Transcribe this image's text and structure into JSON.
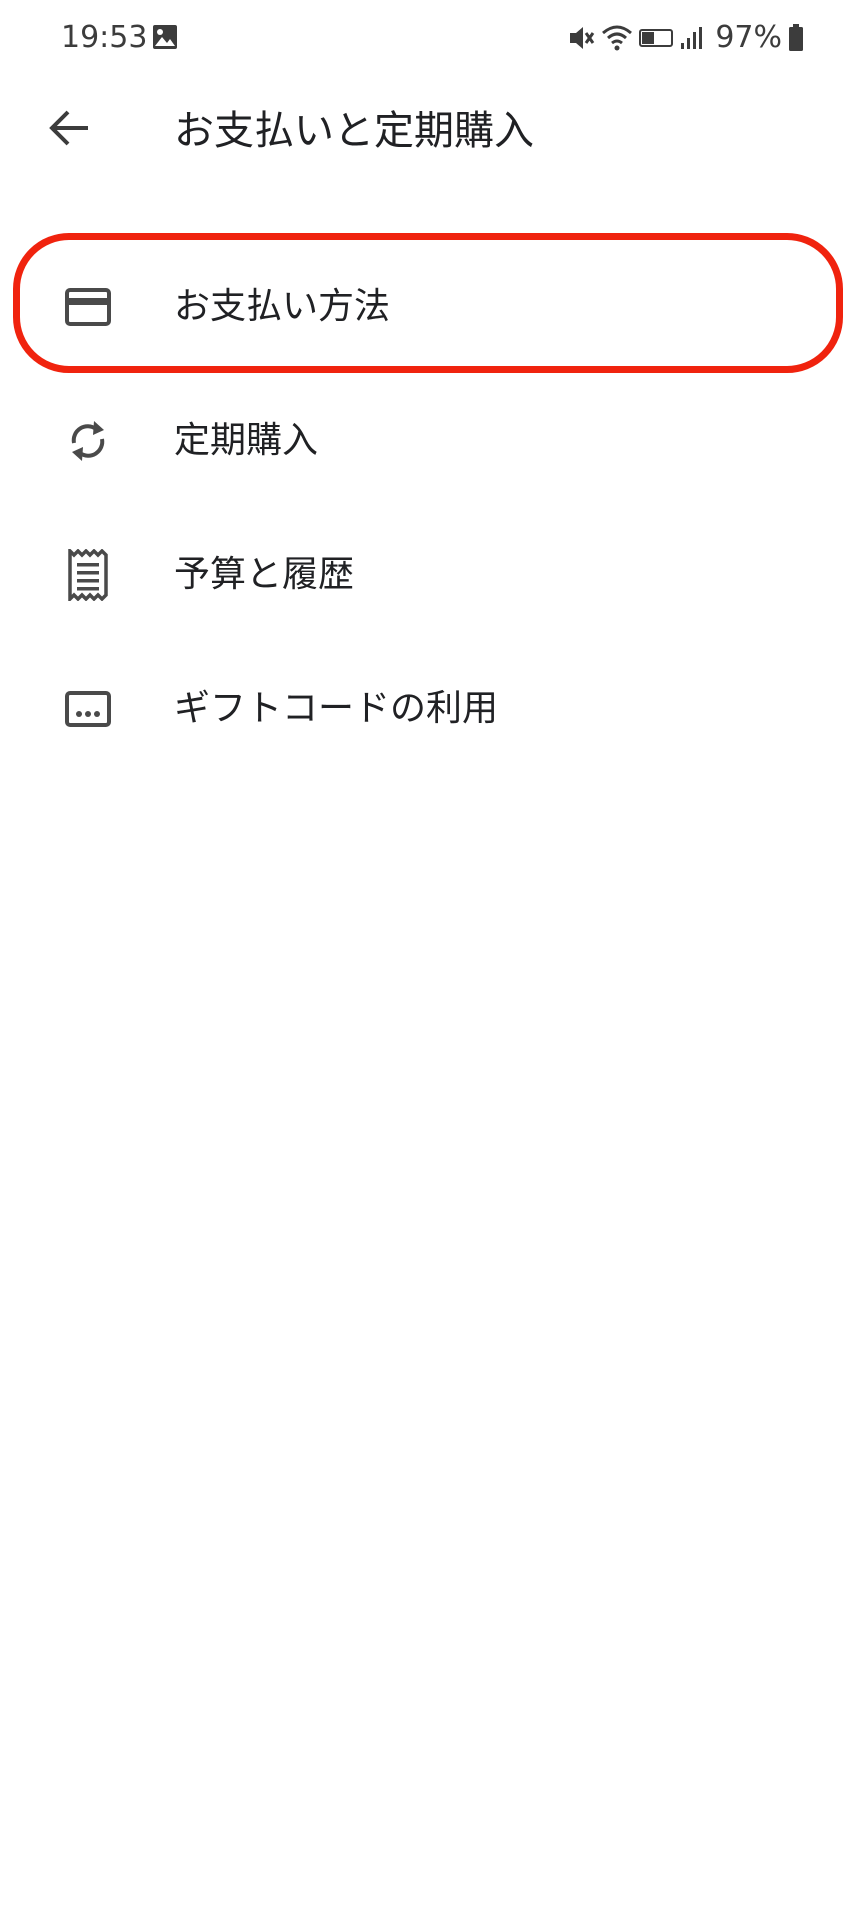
{
  "status_bar": {
    "time": "19:53",
    "battery": "97%",
    "icons": [
      "gallery-icon",
      "vibrate-mute-icon",
      "wifi-icon",
      "volte-icon",
      "signal-icon",
      "battery-icon"
    ]
  },
  "app_bar": {
    "back_icon": "arrow-back-icon",
    "title": "お支払いと定期購入"
  },
  "menu": {
    "items": [
      {
        "label": "お支払い方法",
        "icon": "credit-card-icon"
      },
      {
        "label": "定期購入",
        "icon": "refresh-cycle-icon"
      },
      {
        "label": "予算と履歴",
        "icon": "receipt-icon"
      },
      {
        "label": "ギフトコードの利用",
        "icon": "redeem-code-icon"
      }
    ]
  },
  "colors": {
    "highlight": "#f0230e",
    "icon": "#4a4a4a",
    "text": "#202124",
    "background": "#ffffff"
  }
}
